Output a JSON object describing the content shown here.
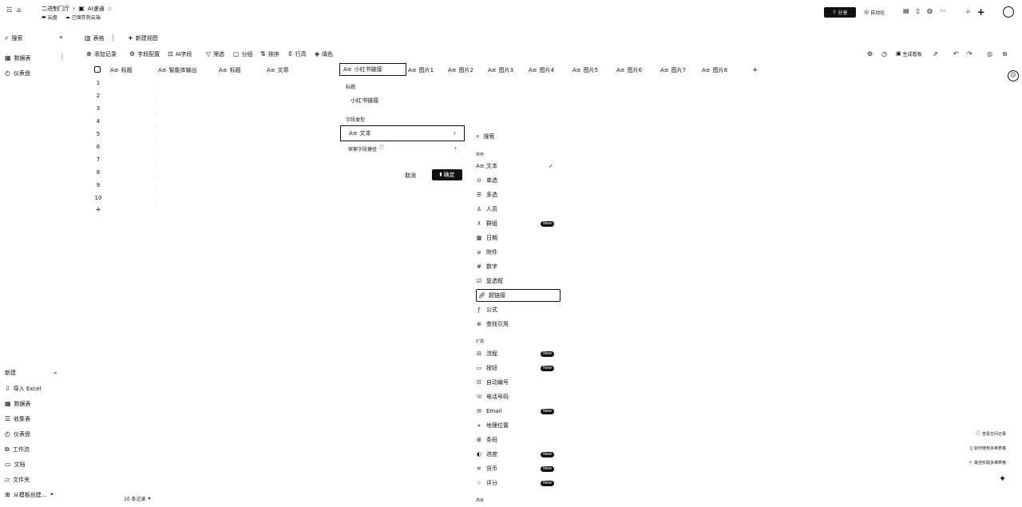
{
  "header": {
    "breadcrumb_parent": "二进制门厅",
    "doc_title": "AI速通",
    "star": "☆",
    "sub_left": "云盘",
    "sub_right": "已保存到云端",
    "share_label": "分享",
    "auto_label": "自动化"
  },
  "sidebar": {
    "search_label": "搜索",
    "items": [
      {
        "label": "数据表"
      },
      {
        "label": "仪表盘"
      }
    ],
    "new_section": "新建",
    "new_items": [
      {
        "label": "导入 Excel",
        "icon": "import-icon"
      },
      {
        "label": "数据表",
        "icon": "table-icon"
      },
      {
        "label": "收集表",
        "icon": "form-icon"
      },
      {
        "label": "仪表盘",
        "icon": "dashboard-icon"
      },
      {
        "label": "工作流",
        "icon": "workflow-icon"
      },
      {
        "label": "文档",
        "icon": "doc-icon"
      },
      {
        "label": "文件夹",
        "icon": "folder-icon"
      },
      {
        "label": "从模板创建...",
        "icon": "template-icon"
      }
    ]
  },
  "view_bar": {
    "view_label": "表格",
    "add_view": "新建视图"
  },
  "toolbar": {
    "items": [
      "添加记录",
      "字段配置",
      "AI字段",
      "筛选",
      "分组",
      "排序",
      "行高",
      "填色"
    ],
    "generate": "生成看板"
  },
  "grid": {
    "columns": [
      "标题",
      "智能体输出",
      "标题",
      "文章",
      "小红书链接",
      "图片1",
      "图片2",
      "图片3",
      "图片4",
      "图片5",
      "图片6",
      "图片7",
      "图片8"
    ],
    "col_prefix": "A≡",
    "rows": [
      "1",
      "2",
      "3",
      "4",
      "5",
      "6",
      "7",
      "8",
      "9",
      "10"
    ],
    "add": "+",
    "footer": "10 条记录"
  },
  "field_editor": {
    "title_label": "标题",
    "title_value": "小红书链接",
    "type_label": "字段类型",
    "type_value": "文本",
    "type_prefix": "A≡",
    "more_label": "探索字段捷径",
    "cancel": "取消",
    "confirm": "确定"
  },
  "type_menu": {
    "search_placeholder": "搜索",
    "sections": [
      {
        "title": "常用",
        "items": [
          {
            "label": "文本",
            "icon": "text-icon",
            "check": true
          },
          {
            "label": "单选",
            "icon": "single-select-icon"
          },
          {
            "label": "多选",
            "icon": "multi-select-icon"
          },
          {
            "label": "人员",
            "icon": "person-icon"
          },
          {
            "label": "群组",
            "icon": "group-icon",
            "new": true
          },
          {
            "label": "日期",
            "icon": "date-icon"
          },
          {
            "label": "附件",
            "icon": "attachment-icon"
          },
          {
            "label": "数字",
            "icon": "number-icon"
          },
          {
            "label": "复选框",
            "icon": "checkbox-icon"
          },
          {
            "label": "超链接",
            "icon": "link-icon",
            "selected": true
          },
          {
            "label": "公式",
            "icon": "formula-icon"
          },
          {
            "label": "查找引用",
            "icon": "lookup-icon"
          }
        ]
      },
      {
        "title": "扩展",
        "items": [
          {
            "label": "流程",
            "icon": "process-icon",
            "new": true
          },
          {
            "label": "按钮",
            "icon": "button-icon",
            "new": true
          },
          {
            "label": "自动编号",
            "icon": "autonumber-icon"
          },
          {
            "label": "电话号码",
            "icon": "phone-icon"
          },
          {
            "label": "Email",
            "icon": "email-icon",
            "new": true
          },
          {
            "label": "地理位置",
            "icon": "location-icon"
          },
          {
            "label": "条码",
            "icon": "barcode-icon"
          },
          {
            "label": "进度",
            "icon": "progress-icon",
            "new": true
          },
          {
            "label": "货币",
            "icon": "currency-icon",
            "new": true
          },
          {
            "label": "评分",
            "icon": "rating-icon",
            "new": true
          }
        ]
      }
    ],
    "bottom_section": "高级",
    "new_badge": "New"
  },
  "right_panel": {
    "items": [
      "查看空间记录",
      "如何使用多维表格",
      "最佳实践多维表格"
    ]
  }
}
